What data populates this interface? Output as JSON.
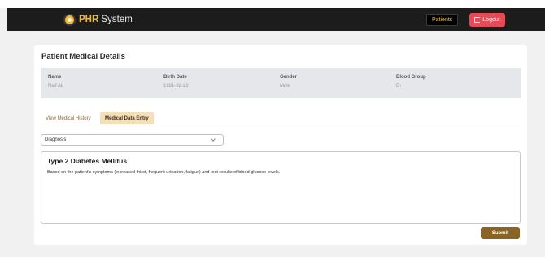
{
  "navbar": {
    "brand_accent": "PHR",
    "brand_rest": " System",
    "patients_label": "Patients",
    "logout_label": "Logout"
  },
  "card": {
    "title": "Patient Medical Details"
  },
  "patient": {
    "name_label": "Name",
    "name_value": "Naif Ali",
    "birth_label": "Birth Date",
    "birth_value": "1981-02-22",
    "gender_label": "Gender",
    "gender_value": "Male",
    "blood_label": "Blood Group",
    "blood_value": "B+"
  },
  "tabs": {
    "history": "View Medical History",
    "entry": "Medical Data Entry"
  },
  "form": {
    "type_selected": "Diagnosis",
    "diagnosis_title": "Type 2 Diabetes Mellitus",
    "diagnosis_text": "Based on the patient's symptoms (increased thirst, frequent urination, fatigue) and test results of blood glucose levels.",
    "submit_label": "Submit"
  },
  "colors": {
    "navbar": "#1c1c1c",
    "accent": "#f0b73c",
    "logout": "#e64a57",
    "submit": "#8a6425",
    "active_tab": "#f4dfb8"
  },
  "icons": {
    "brand": "sun-logo-icon",
    "logout": "logout-icon",
    "select": "chevron-down-icon"
  }
}
